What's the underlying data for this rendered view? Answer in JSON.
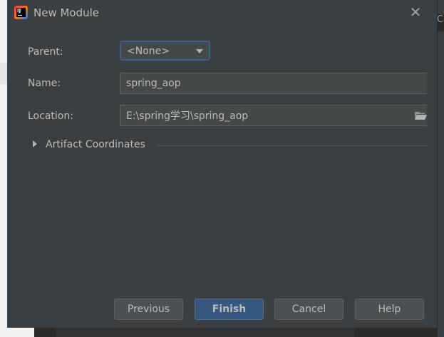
{
  "dialog": {
    "title": "New Module",
    "app_icon": "intellij-idea-icon",
    "close_icon": "close-icon"
  },
  "form": {
    "parent_label": "Parent:",
    "parent_value": "<None>",
    "name_label": "Name:",
    "name_value": "spring_aop",
    "location_label": "Location:",
    "location_value": "E:\\spring学习\\spring_aop",
    "browse_icon": "folder-icon"
  },
  "artifact": {
    "label": "Artifact Coordinates",
    "expanded": false
  },
  "buttons": {
    "previous": "Previous",
    "finish": "Finish",
    "cancel": "Cancel",
    "help": "Help"
  },
  "background": {
    "right_tab_text": "Co"
  },
  "colors": {
    "dialog_bg": "#3c3f41",
    "field_bg": "#45494a",
    "focus_border": "#3d6185",
    "default_button": "#365880",
    "text": "#bbbbbb"
  }
}
